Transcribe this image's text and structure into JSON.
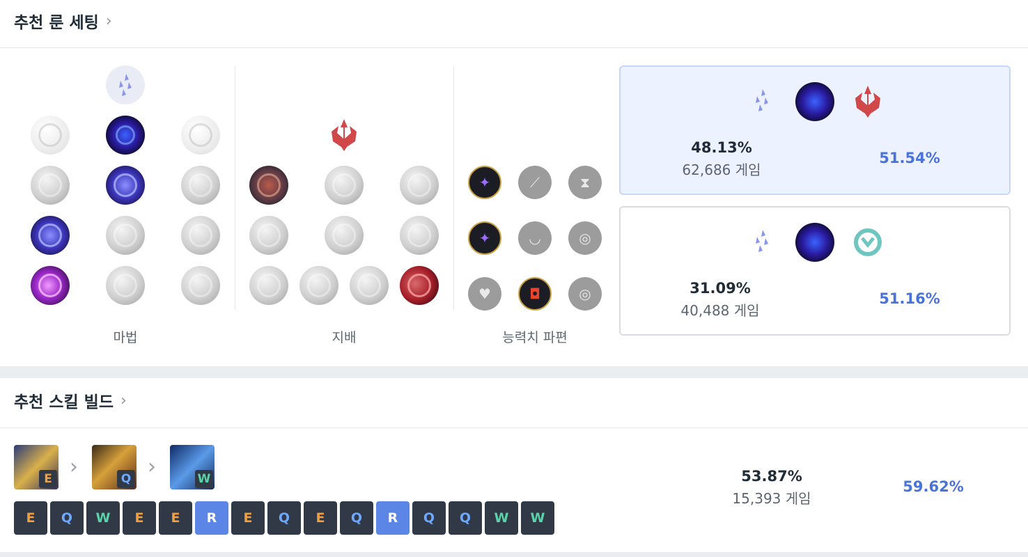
{
  "runes": {
    "title": "추천 룬 세팅",
    "chevron": "›",
    "primary_tree": {
      "label": "마법"
    },
    "secondary_tree": {
      "label": "지배"
    },
    "shards": {
      "label": "능력치 파편"
    },
    "sets": [
      {
        "pick_rate": "48.13%",
        "games": "62,686 게임",
        "win_rate": "51.54%",
        "selected": true
      },
      {
        "pick_rate": "31.09%",
        "games": "40,488 게임",
        "win_rate": "51.16%",
        "selected": false
      }
    ]
  },
  "skills": {
    "title": "추천 스킬 빌드",
    "chevron": "›",
    "arrow": "›",
    "priority": [
      {
        "key": "E"
      },
      {
        "key": "Q"
      },
      {
        "key": "W"
      }
    ],
    "order": [
      "E",
      "Q",
      "W",
      "E",
      "E",
      "R",
      "E",
      "Q",
      "E",
      "Q",
      "R",
      "Q",
      "Q",
      "W",
      "W"
    ],
    "pick_rate": "53.87%",
    "games": "15,393 게임",
    "win_rate": "59.62%"
  },
  "colors": {
    "win_rate": "#4a73d9",
    "key_e": "#f0a040",
    "key_q": "#6fa8ff",
    "key_w": "#5ad3a8",
    "key_r_bg": "#5b86e5",
    "selected_bg": "#ecf2ff"
  },
  "icons": {
    "sorcery": "sorcery-path-icon",
    "domination": "domination-path-icon",
    "resolve": "resolve-path-icon",
    "keystone": "phase-rush-icon"
  }
}
